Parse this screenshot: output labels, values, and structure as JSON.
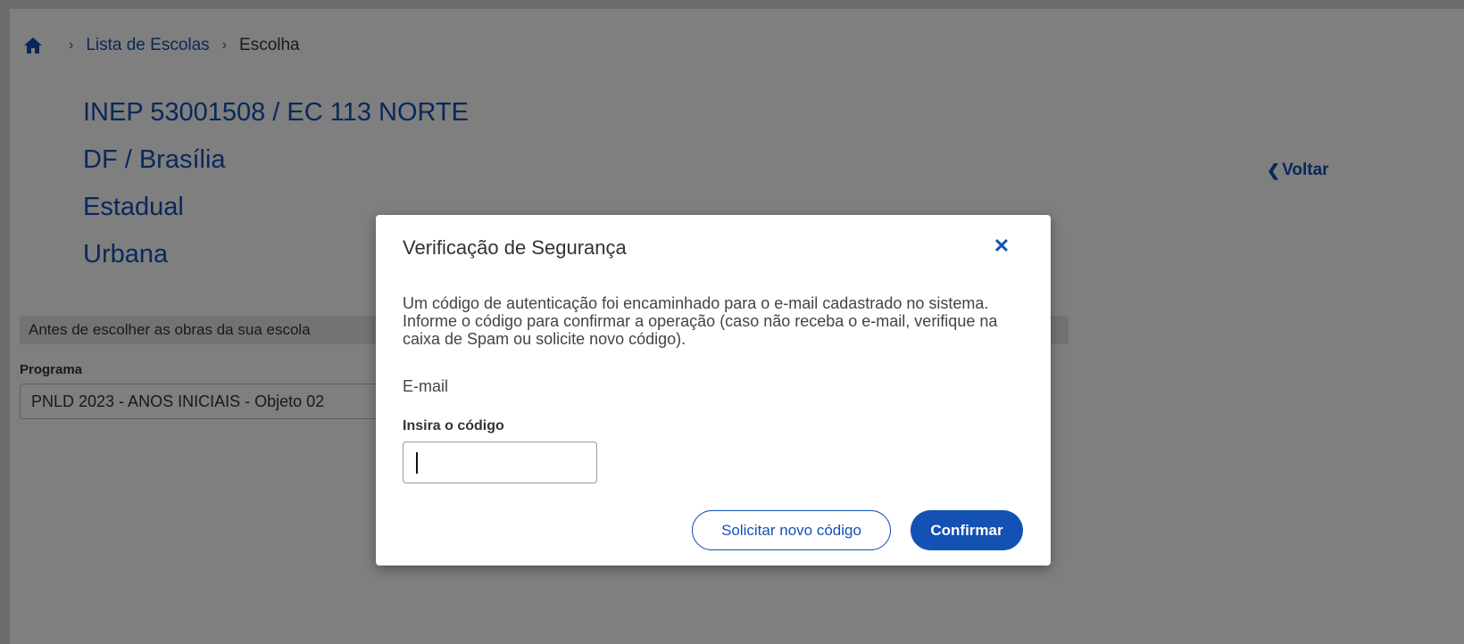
{
  "breadcrumb": {
    "home_icon": "home-icon",
    "items": [
      "Lista de Escolas",
      "Escolha"
    ]
  },
  "school": {
    "inep": "INEP 53001508 / EC 113 NORTE",
    "location": "DF / Brasília",
    "network": "Estadual",
    "zone": "Urbana"
  },
  "voltar_label": "Voltar",
  "notice": "Antes de escolher as obras da sua escola",
  "programa": {
    "label": "Programa",
    "selected": "PNLD 2023 - ANOS INICIAIS - Objeto 02"
  },
  "modal": {
    "title": "Verificação de Segurança",
    "close_icon": "close-icon",
    "body": "Um código de autenticação foi encaminhado para o e-mail cadastrado no sistema. Informe o código para confirmar a operação (caso não receba o e-mail, verifique na caixa de Spam ou solicite novo código).",
    "email_label": "E-mail",
    "code_label": "Insira o código",
    "code_value": "",
    "resend_label": "Solicitar novo código",
    "confirm_label": "Confirmar"
  },
  "colors": {
    "accent": "#1351b4",
    "overlay": "rgba(0,0,0,0.5)"
  }
}
